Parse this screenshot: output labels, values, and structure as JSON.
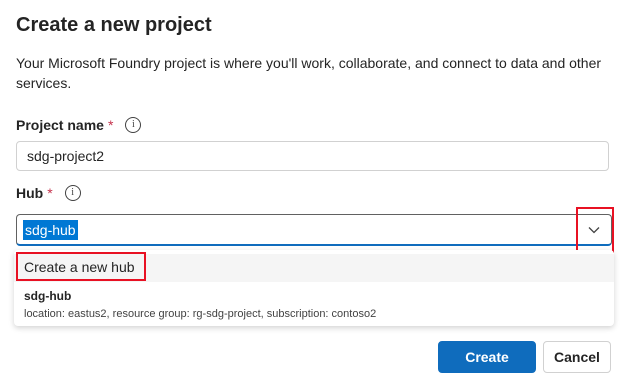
{
  "dialog": {
    "title": "Create a new project",
    "description": "Your Microsoft Foundry project is where you'll work, collaborate, and connect to data and other services."
  },
  "project_name": {
    "label": "Project name",
    "required_mark": "*",
    "info_icon": "info-icon",
    "value": "sdg-project2"
  },
  "hub": {
    "label": "Hub",
    "required_mark": "*",
    "info_icon": "info-icon",
    "value": "sdg-hub",
    "dropdown_icon": "chevron-down-icon",
    "options": [
      {
        "label": "Create a new hub"
      },
      {
        "name": "sdg-hub",
        "detail": "location: eastus2, resource group: rg-sdg-project, subscription: contoso2"
      }
    ]
  },
  "buttons": {
    "create": "Create",
    "cancel": "Cancel"
  },
  "colors": {
    "primary": "#0f6cbd",
    "selection": "#0078d4",
    "highlight_box": "#e81123",
    "required": "#c4314b"
  }
}
